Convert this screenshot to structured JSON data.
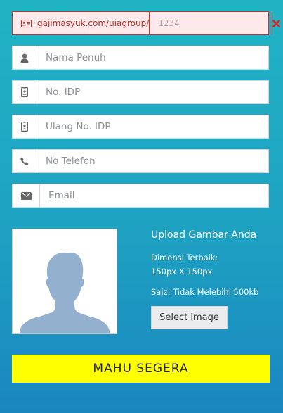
{
  "url_row": {
    "prefix": "gajimasyuk.com/uiagroup/",
    "placeholder": "1234",
    "prefix_icon": "id-card-icon",
    "clear_icon": "close-icon",
    "error_color": "#c9302c"
  },
  "fields": {
    "name": {
      "placeholder": "Nama Penuh",
      "icon": "user-icon"
    },
    "idp": {
      "placeholder": "No. IDP",
      "icon": "id-badge-icon"
    },
    "idp_repeat": {
      "placeholder": "Ulang No. IDP",
      "icon": "id-badge-icon"
    },
    "phone": {
      "placeholder": "No Telefon",
      "icon": "phone-icon"
    },
    "email": {
      "placeholder": "Email",
      "icon": "envelope-icon"
    }
  },
  "upload": {
    "title": "Upload Gambar Anda",
    "dim_line1": "Dimensi Terbaik:",
    "dim_line2": "150px X 150px",
    "size_note": "Saiz: Tidak Melebihi 500kb",
    "select_label": "Select image",
    "placeholder_icon": "avatar-silhouette-icon"
  },
  "submit": {
    "label": "MAHU SEGERA",
    "color": "#ffff00"
  }
}
